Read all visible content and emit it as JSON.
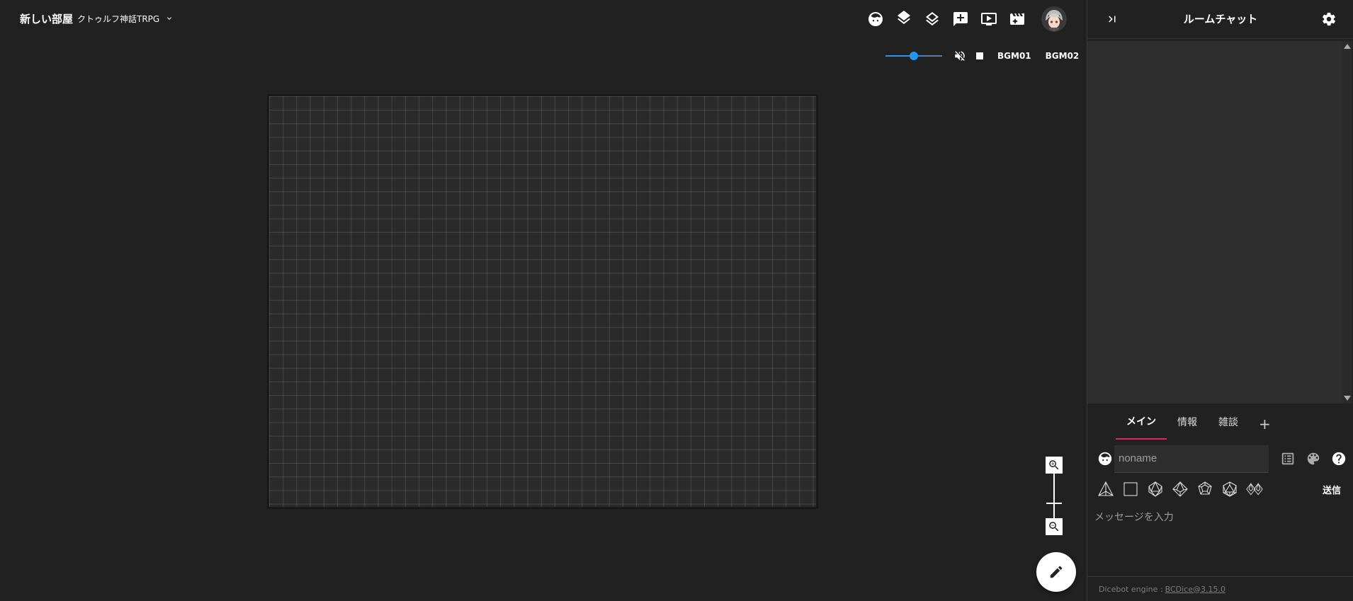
{
  "room": {
    "name": "新しい部屋",
    "system": "クトゥルフ神話TRPG"
  },
  "toolbar": {
    "icons": [
      "character-face-icon",
      "layers-filled-icon",
      "layers-outline-icon",
      "add-comment-icon",
      "screen-icon",
      "media-cut-icon"
    ]
  },
  "bgm": {
    "volume": 0.5,
    "tracks": [
      "BGM01",
      "BGM02"
    ]
  },
  "chat": {
    "title": "ルームチャット",
    "tabs": [
      {
        "label": "メイン",
        "active": true
      },
      {
        "label": "情報",
        "active": false
      },
      {
        "label": "雑談",
        "active": false
      }
    ],
    "add_tab": "+",
    "speaker_placeholder": "noname",
    "send_label": "送信",
    "message_placeholder": "メッセージを入力",
    "dicebot_prefix": "Dicebot engine :",
    "dicebot_link": "BCDice@3.15.0"
  },
  "colors": {
    "accent_tab": "#e91e63",
    "slider": "#2196f3",
    "background": "#212121"
  }
}
